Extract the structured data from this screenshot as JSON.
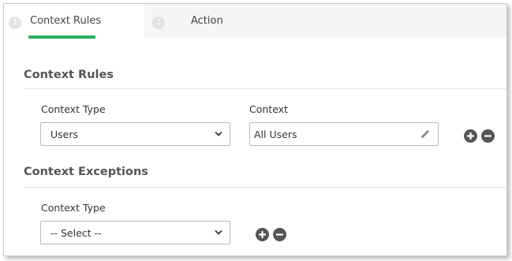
{
  "tabs": [
    {
      "step": "1",
      "label": "Context Rules",
      "active": true
    },
    {
      "step": "2",
      "label": "Action",
      "active": false
    }
  ],
  "context_rules": {
    "title": "Context Rules",
    "type_label": "Context Type",
    "type_value": "Users",
    "context_label": "Context",
    "context_value": "All Users"
  },
  "context_exceptions": {
    "title": "Context Exceptions",
    "type_label": "Context Type",
    "type_value": "-- Select --"
  },
  "colors": {
    "accent": "#27ae60",
    "button": "#555555"
  },
  "icons": [
    "chevron-down-icon",
    "pencil-icon",
    "plus-icon",
    "minus-icon"
  ]
}
